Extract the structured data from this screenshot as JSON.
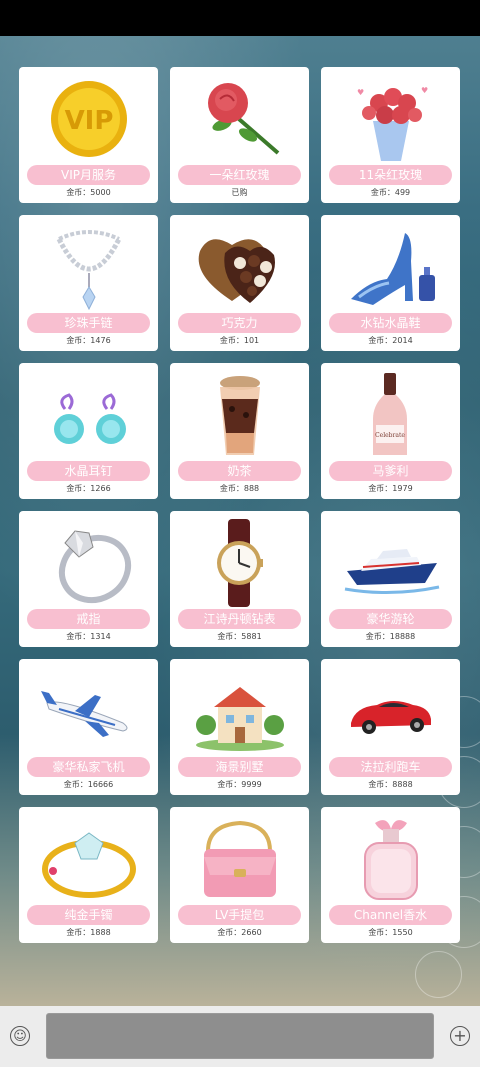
{
  "gifts": [
    {
      "name": "VIP月服务",
      "price": "金币：5000",
      "icon": "vip-coin-icon"
    },
    {
      "name": "一朵红玫瑰",
      "price": "已购",
      "icon": "red-rose-icon"
    },
    {
      "name": "11朵红玫瑰",
      "price": "金币：499",
      "icon": "rose-bouquet-icon"
    },
    {
      "name": "珍珠手链",
      "price": "金币：1476",
      "icon": "pearl-necklace-icon"
    },
    {
      "name": "巧克力",
      "price": "金币：101",
      "icon": "chocolate-box-icon"
    },
    {
      "name": "水钻水晶鞋",
      "price": "金币：2014",
      "icon": "crystal-shoe-icon"
    },
    {
      "name": "水晶耳钉",
      "price": "金币：1266",
      "icon": "crystal-earrings-icon"
    },
    {
      "name": "奶茶",
      "price": "金币：888",
      "icon": "milk-tea-icon"
    },
    {
      "name": "马爹利",
      "price": "金币：1979",
      "icon": "liquor-bottle-icon"
    },
    {
      "name": "戒指",
      "price": "金币：1314",
      "icon": "diamond-ring-icon"
    },
    {
      "name": "江诗丹顿钻表",
      "price": "金币：5881",
      "icon": "wrist-watch-icon"
    },
    {
      "name": "豪华游轮",
      "price": "金币：18888",
      "icon": "cruise-ship-icon"
    },
    {
      "name": "豪华私家飞机",
      "price": "金币：16666",
      "icon": "private-jet-icon"
    },
    {
      "name": "海景别墅",
      "price": "金币：9999",
      "icon": "villa-icon"
    },
    {
      "name": "法拉利跑车",
      "price": "金币：8888",
      "icon": "sports-car-icon"
    },
    {
      "name": "纯金手镯",
      "price": "金币：1888",
      "icon": "gold-bracelet-icon"
    },
    {
      "name": "LV手提包",
      "price": "金币：2660",
      "icon": "handbag-icon"
    },
    {
      "name": "Channel香水",
      "price": "金币：1550",
      "icon": "perfume-icon"
    }
  ],
  "input": {
    "placeholder": ""
  },
  "colors": {
    "pill": "#f8bfd0",
    "bar": "#ececec"
  }
}
